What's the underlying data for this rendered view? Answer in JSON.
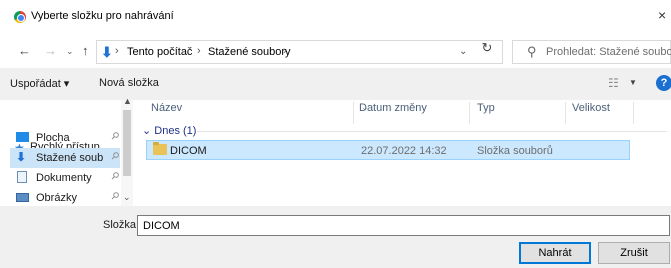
{
  "window": {
    "title": "Vyberte složku pro nahrávání",
    "close_glyph": "×"
  },
  "address": {
    "crumbs": [
      "Tento počítač",
      "Stažené soubory"
    ],
    "separator": "›",
    "search_placeholder": "Prohledat: Stažené soubory"
  },
  "toolbar": {
    "organize": "Uspořádat ▾",
    "new_folder": "Nová složka",
    "help": "?"
  },
  "nav": {
    "quick_access": "Rychlý přístup",
    "items": [
      {
        "label": "Plocha",
        "icon": "desktop-icon",
        "pinned": true,
        "selected": false
      },
      {
        "label": "Stažené soub",
        "icon": "download-icon",
        "pinned": true,
        "selected": true
      },
      {
        "label": "Dokumenty",
        "icon": "documents-icon",
        "pinned": true,
        "selected": false
      },
      {
        "label": "Obrázky",
        "icon": "pictures-icon",
        "pinned": true,
        "selected": false
      }
    ]
  },
  "files": {
    "columns": [
      "Název",
      "Datum změny",
      "Typ",
      "Velikost"
    ],
    "group_label": "Dnes (1)",
    "rows": [
      {
        "name": "DICOM",
        "date": "22.07.2022 14:32",
        "type": "Složka souborů",
        "size": "",
        "selected": true
      }
    ]
  },
  "bottom": {
    "folder_label": "Složka:",
    "folder_value": "DICOM",
    "upload_button": "Nahrát",
    "cancel_button": "Zrušit"
  },
  "colors": {
    "selection": "#cce8ff",
    "accent": "#0078d7",
    "group_text": "#1e3287"
  }
}
